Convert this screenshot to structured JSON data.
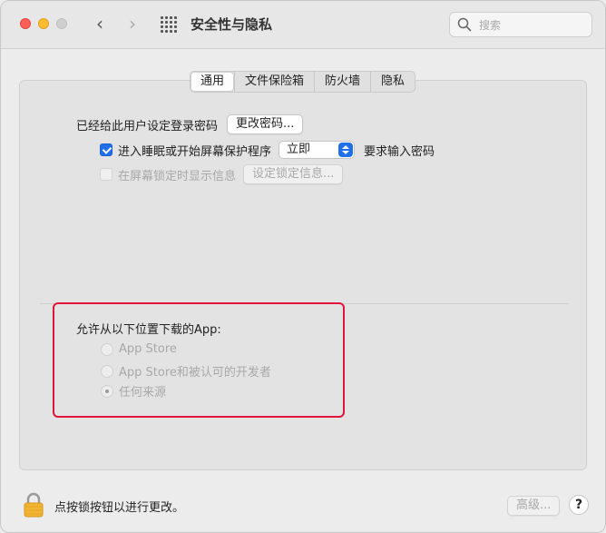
{
  "window": {
    "title": "安全性与隐私"
  },
  "nav": {
    "back_glyph": "‹",
    "forward_glyph": "›"
  },
  "search": {
    "placeholder": "搜索"
  },
  "tabs": [
    {
      "label": "通用",
      "active": true
    },
    {
      "label": "文件保险箱",
      "active": false
    },
    {
      "label": "防火墙",
      "active": false
    },
    {
      "label": "隐私",
      "active": false
    }
  ],
  "general": {
    "password_label": "已经给此用户设定登录密码",
    "change_password_button": "更改密码...",
    "sleep_checkbox_label": "进入睡眠或开始屏幕保护程序",
    "sleep_select_value": "立即",
    "require_password_label": "要求输入密码",
    "lock_message_label": "在屏幕锁定时显示信息",
    "set_lock_message_button": "设定锁定信息..."
  },
  "downloads": {
    "heading": "允许从以下位置下载的App:",
    "options": [
      {
        "label": "App Store",
        "selected": false
      },
      {
        "label": "App Store和被认可的开发者",
        "selected": false
      },
      {
        "label": "任何来源",
        "selected": true
      }
    ]
  },
  "footer": {
    "lock_text": "点按锁按钮以进行更改。",
    "advanced_button": "高级...",
    "help_button": "?"
  },
  "colors": {
    "accent": "#1f6feb",
    "highlight": "#e0143c",
    "close": "#ff5f57",
    "minimize": "#febc2e"
  },
  "icons": [
    "search-icon",
    "grid-icon",
    "lock-icon",
    "chevron-left-icon",
    "chevron-right-icon"
  ]
}
